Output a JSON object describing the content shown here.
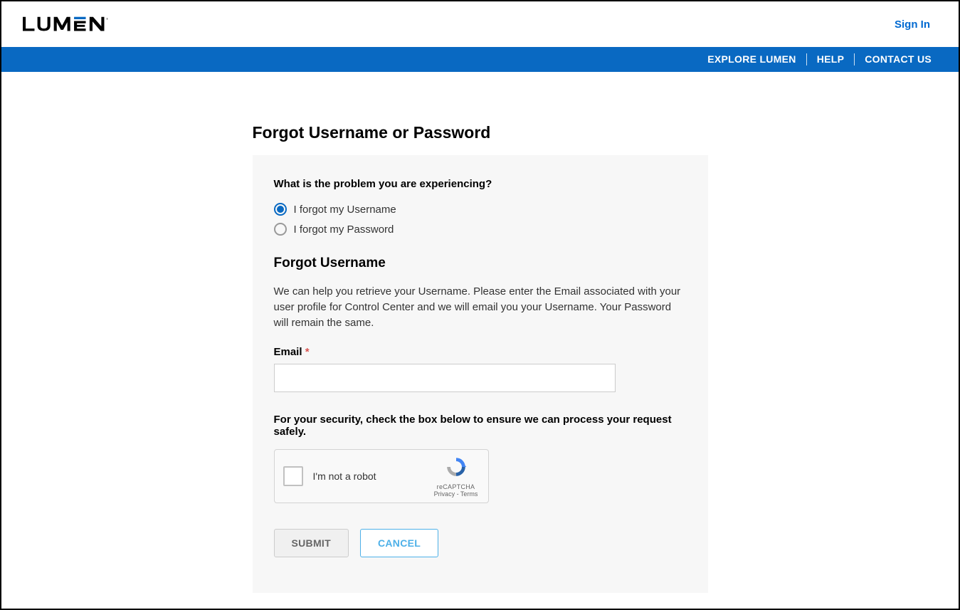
{
  "header": {
    "signin": "Sign In"
  },
  "nav": {
    "explore": "EXPLORE LUMEN",
    "help": "HELP",
    "contact": "CONTACT US"
  },
  "page": {
    "title": "Forgot Username or Password"
  },
  "form": {
    "question": "What is the problem you are experiencing?",
    "radio_username": "I forgot my Username",
    "radio_password": "I forgot my Password",
    "section_title": "Forgot Username",
    "help_text": "We can help you retrieve your Username. Please enter the Email associated with your user profile for Control Center and we will email you your Username. Your Password will remain the same.",
    "email_label": "Email",
    "email_value": "",
    "security_text": "For your security, check the box below to ensure we can process your request safely.",
    "recaptcha_label": "I'm not a robot",
    "recaptcha_brand": "reCAPTCHA",
    "recaptcha_privacy": "Privacy",
    "recaptcha_terms": "Terms",
    "submit": "SUBMIT",
    "cancel": "CANCEL"
  }
}
